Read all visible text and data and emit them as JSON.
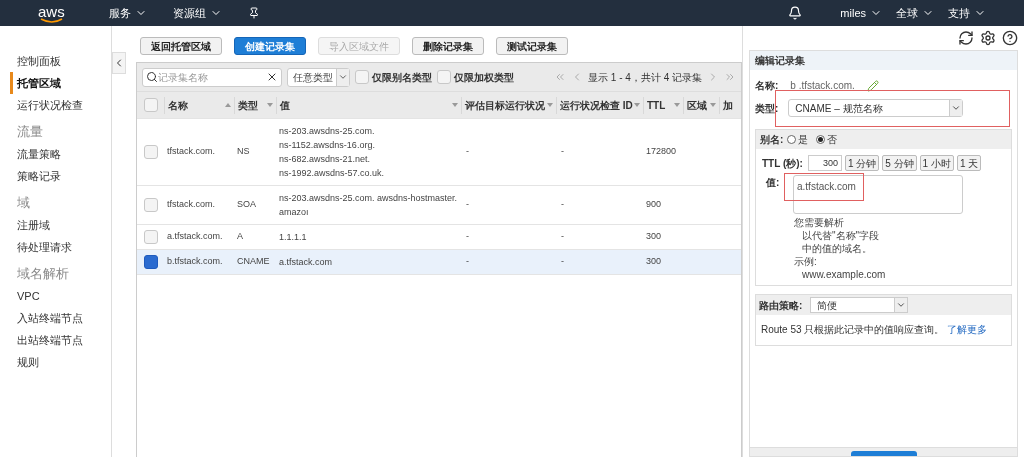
{
  "topbar": {
    "logo": "aws",
    "menus": [
      {
        "label": "服务",
        "caret": true
      },
      {
        "label": "资源组",
        "caret": true
      }
    ],
    "right": [
      {
        "label": "miles"
      },
      {
        "label": "全球"
      },
      {
        "label": "支持"
      }
    ]
  },
  "sidebar": {
    "items": [
      {
        "kind": "link",
        "label": "控制面板",
        "selected": false
      },
      {
        "kind": "link",
        "label": "托管区域",
        "selected": true
      },
      {
        "kind": "link",
        "label": "运行状况检查",
        "selected": false
      },
      {
        "kind": "heading",
        "label": "流量"
      },
      {
        "kind": "link",
        "label": "流量策略",
        "selected": false
      },
      {
        "kind": "link",
        "label": "策略记录",
        "selected": false
      },
      {
        "kind": "heading",
        "label": "域"
      },
      {
        "kind": "link",
        "label": "注册域",
        "selected": false
      },
      {
        "kind": "link",
        "label": "待处理请求",
        "selected": false
      },
      {
        "kind": "heading",
        "label": "域名解析"
      },
      {
        "kind": "link",
        "label": "VPC",
        "selected": false
      },
      {
        "kind": "link",
        "label": "入站终端节点",
        "selected": false
      },
      {
        "kind": "link",
        "label": "出站终端节点",
        "selected": false
      },
      {
        "kind": "link",
        "label": "规则",
        "selected": false
      }
    ]
  },
  "toolbar": [
    {
      "label": "返回托管区域",
      "kind": "default",
      "disabled": false
    },
    {
      "label": "创建记录集",
      "kind": "primary",
      "disabled": false
    },
    {
      "label": "导入区域文件",
      "kind": "default",
      "disabled": true
    },
    {
      "label": "删除记录集",
      "kind": "default",
      "disabled": false
    },
    {
      "label": "测试记录集",
      "kind": "default",
      "disabled": false
    }
  ],
  "filters": {
    "search": {
      "placeholder": "记录集名称"
    },
    "type_select": "任意类型",
    "checkboxes": [
      {
        "label": "仅限别名类型",
        "checked": false
      },
      {
        "label": "仅限加权类型",
        "checked": false
      }
    ],
    "pager": "显示 1 - 4，共计 4 记录集"
  },
  "table": {
    "columns": [
      "名称",
      "类型",
      "值",
      "评估目标运行状况",
      "运行状况检查 ID",
      "TTL",
      "区域",
      "加"
    ],
    "header_checked": false,
    "rows": [
      {
        "selected": false,
        "name": "tfstack.com.",
        "type": "NS",
        "values": [
          "ns-203.awsdns-25.com.",
          "ns-1152.awsdns-16.org.",
          "ns-682.awsdns-21.net.",
          "ns-1992.awsdns-57.co.uk."
        ],
        "health": "-",
        "health_id": "-",
        "ttl": "172800"
      },
      {
        "selected": false,
        "name": "tfstack.com.",
        "type": "SOA",
        "values": [
          "ns-203.awsdns-25.com. awsdns-hostmaster.amazoı"
        ],
        "health": "-",
        "health_id": "-",
        "ttl": "900"
      },
      {
        "selected": false,
        "name": "a.tfstack.com.",
        "type": "A",
        "values": [
          "1.1.1.1"
        ],
        "health": "-",
        "health_id": "-",
        "ttl": "300"
      },
      {
        "selected": true,
        "name": "b.tfstack.com.",
        "type": "CNAME",
        "values": [
          "a.tfstack.com"
        ],
        "health": "-",
        "health_id": "-",
        "ttl": "300"
      }
    ]
  },
  "editor": {
    "title": "编辑记录集",
    "name_label": "名称:",
    "name_value": "b .tfstack.com.",
    "type_label": "类型:",
    "type_value": "CNAME – 规范名称",
    "alias_label": "别名:",
    "alias_options": [
      {
        "label": "是",
        "selected": false
      },
      {
        "label": "否",
        "selected": true
      }
    ],
    "ttl_label": "TTL (秒):",
    "ttl_value": "300",
    "ttl_presets": [
      "1 分钟",
      "5 分钟",
      "1 小时",
      "1 天"
    ],
    "value_label": "值:",
    "value": "a.tfstack.com",
    "hint": [
      "您需要解析",
      "以代替\"名称\"字段",
      "中的值的域名。",
      "示例:",
      "www.example.com"
    ],
    "routing_label": "路由策略:",
    "routing_value": "简便",
    "routing_note": "Route 53 只根据此记录中的值响应查询。",
    "learn_more": "了解更多"
  }
}
